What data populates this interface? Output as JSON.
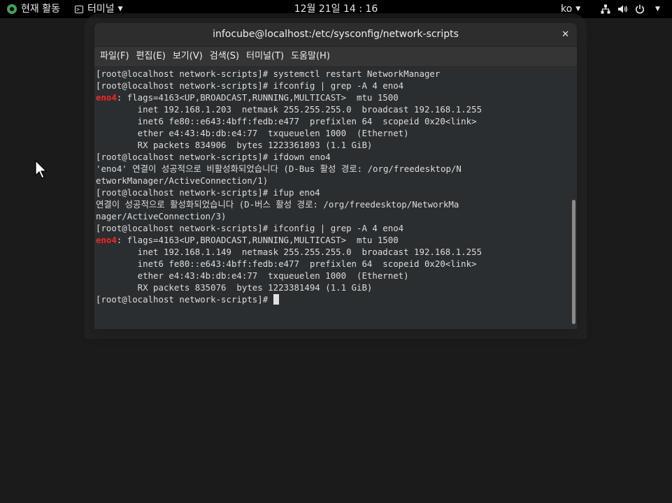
{
  "topbar": {
    "activities": "현재 활동",
    "app_menu": "터미널",
    "clock": "12월 21일  14 : 16",
    "lang": "ko",
    "network_icon": "network-icon",
    "volume_icon": "volume-icon",
    "power_icon": "power-icon"
  },
  "window": {
    "title": "infocube@localhost:/etc/sysconfig/network-scripts",
    "close_label": "✕"
  },
  "menubar": [
    "파일(F)",
    "편집(E)",
    "보기(V)",
    "검색(S)",
    "터미널(T)",
    "도움말(H)"
  ],
  "terminal": {
    "lines": [
      {
        "text": "[root@localhost network-scripts]# systemctl restart NetworkManager"
      },
      {
        "text": "[root@localhost network-scripts]# ifconfig | grep -A 4 eno4"
      },
      {
        "iface": "eno4",
        "text": ": flags=4163<UP,BROADCAST,RUNNING,MULTICAST>  mtu 1500"
      },
      {
        "text": "        inet 192.168.1.203  netmask 255.255.255.0  broadcast 192.168.1.255"
      },
      {
        "text": "        inet6 fe80::e643:4bff:fedb:e477  prefixlen 64  scopeid 0x20<link>"
      },
      {
        "text": "        ether e4:43:4b:db:e4:77  txqueuelen 1000  (Ethernet)"
      },
      {
        "text": "        RX packets 834906  bytes 1223361893 (1.1 GiB)"
      },
      {
        "text": "[root@localhost network-scripts]# ifdown eno4"
      },
      {
        "text": "'eno4' 연결이 성공적으로 비활성화되었습니다 (D-Bus 활성 경로: /org/freedesktop/N"
      },
      {
        "text": "etworkManager/ActiveConnection/1)"
      },
      {
        "text": "[root@localhost network-scripts]# ifup eno4"
      },
      {
        "text": "연결이 성공적으로 활성화되었습니다 (D-버스 활성 경로: /org/freedesktop/NetworkMa"
      },
      {
        "text": "nager/ActiveConnection/3)"
      },
      {
        "text": "[root@localhost network-scripts]# ifconfig | grep -A 4 eno4"
      },
      {
        "iface": "eno4",
        "text": ": flags=4163<UP,BROADCAST,RUNNING,MULTICAST>  mtu 1500"
      },
      {
        "text": "        inet 192.168.1.149  netmask 255.255.255.0  broadcast 192.168.1.255"
      },
      {
        "text": "        inet6 fe80::e643:4bff:fedb:e477  prefixlen 64  scopeid 0x20<link>"
      },
      {
        "text": "        ether e4:43:4b:db:e4:77  txqueuelen 1000  (Ethernet)"
      },
      {
        "text": "        RX packets 835076  bytes 1223381494 (1.1 GiB)"
      },
      {
        "text": "[root@localhost network-scripts]# ",
        "cursor": true
      }
    ]
  },
  "colors": {
    "iface_highlight": "#ef2929",
    "terminal_bg": "#2b2e30"
  }
}
